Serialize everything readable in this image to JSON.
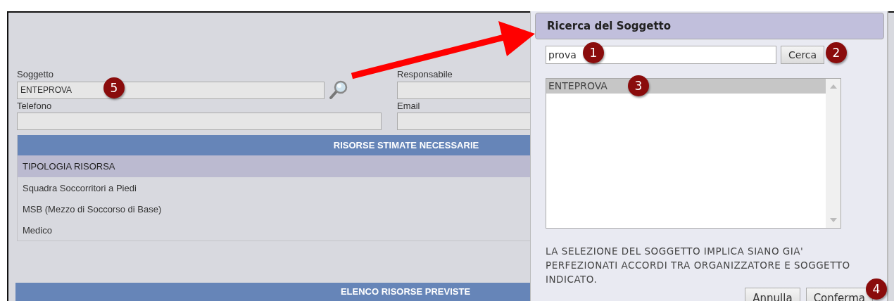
{
  "form": {
    "fields": [
      {
        "label": "Soggetto",
        "value": "ENTEPROVA",
        "kind": "lookup"
      },
      {
        "label": "Responsabile",
        "kind": "text"
      },
      {
        "label": "Telefono",
        "kind": "text"
      },
      {
        "label": "Email",
        "kind": "text"
      }
    ]
  },
  "resources_table": {
    "title": "RISORSE STIMATE NECESSARIE",
    "columns": [
      "TIPOLOGIA RISORSA"
    ],
    "rows": [
      [
        "Squadra Soccorritori a Piedi"
      ],
      [
        "MSB (Mezzo di Soccorso di Base)"
      ],
      [
        "Medico"
      ]
    ]
  },
  "planned_section": {
    "title": "ELENCO RISORSE PREVISTE"
  },
  "dialog": {
    "title": "Ricerca del Soggetto",
    "search": {
      "value": "prova"
    },
    "search_button": "Cerca",
    "results": [
      {
        "label": "ENTEPROVA",
        "selected": true
      }
    ],
    "note": "LA SELEZIONE DEL SOGGETTO IMPLICA SIANO GIA' PERFEZIONATI ACCORDI TRA ORGANIZZATORE E SOGGETTO INDICATO.",
    "buttons": [
      "Annulla",
      "Conferma"
    ]
  },
  "callouts": [
    "5",
    "1",
    "2",
    "3",
    "4"
  ]
}
